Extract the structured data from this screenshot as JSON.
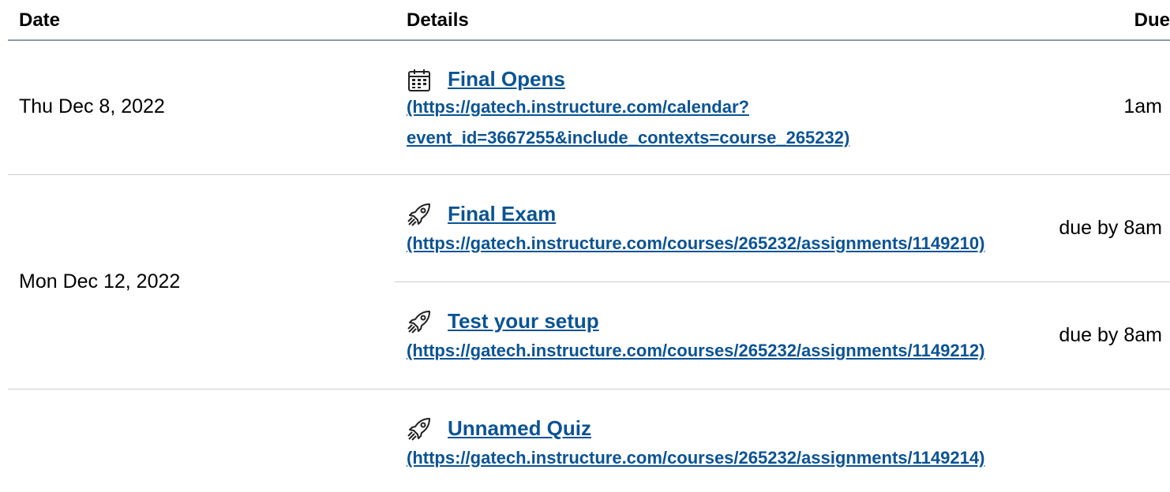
{
  "header": {
    "date_label": "Date",
    "details_label": "Details",
    "due_label": "Due"
  },
  "rows": [
    {
      "date": "Thu Dec 8, 2022",
      "events": [
        {
          "icon": "calendar-icon",
          "title": "Final Opens",
          "url_line1": "(https://gatech.instructure.com/calendar?",
          "url_line2": "event_id=3667255&include_contexts=course_265232)",
          "due": "1am"
        }
      ]
    },
    {
      "date": "Mon Dec 12, 2022",
      "events": [
        {
          "icon": "rocket-icon",
          "title": "Final Exam",
          "url": "(https://gatech.instructure.com/courses/265232/assignments/1149210)",
          "due": "due by 8am"
        },
        {
          "icon": "rocket-icon",
          "title": "Test your setup",
          "url": "(https://gatech.instructure.com/courses/265232/assignments/1149212)",
          "due": "due by 8am"
        }
      ]
    },
    {
      "date": "",
      "events": [
        {
          "icon": "rocket-icon",
          "title": "Unnamed Quiz",
          "url": "(https://gatech.instructure.com/courses/265232/assignments/1149214)",
          "due": ""
        }
      ]
    }
  ],
  "colors": {
    "link": "#0b5394",
    "header_border": "#8b9aa8",
    "row_border": "#c7cdd1"
  }
}
